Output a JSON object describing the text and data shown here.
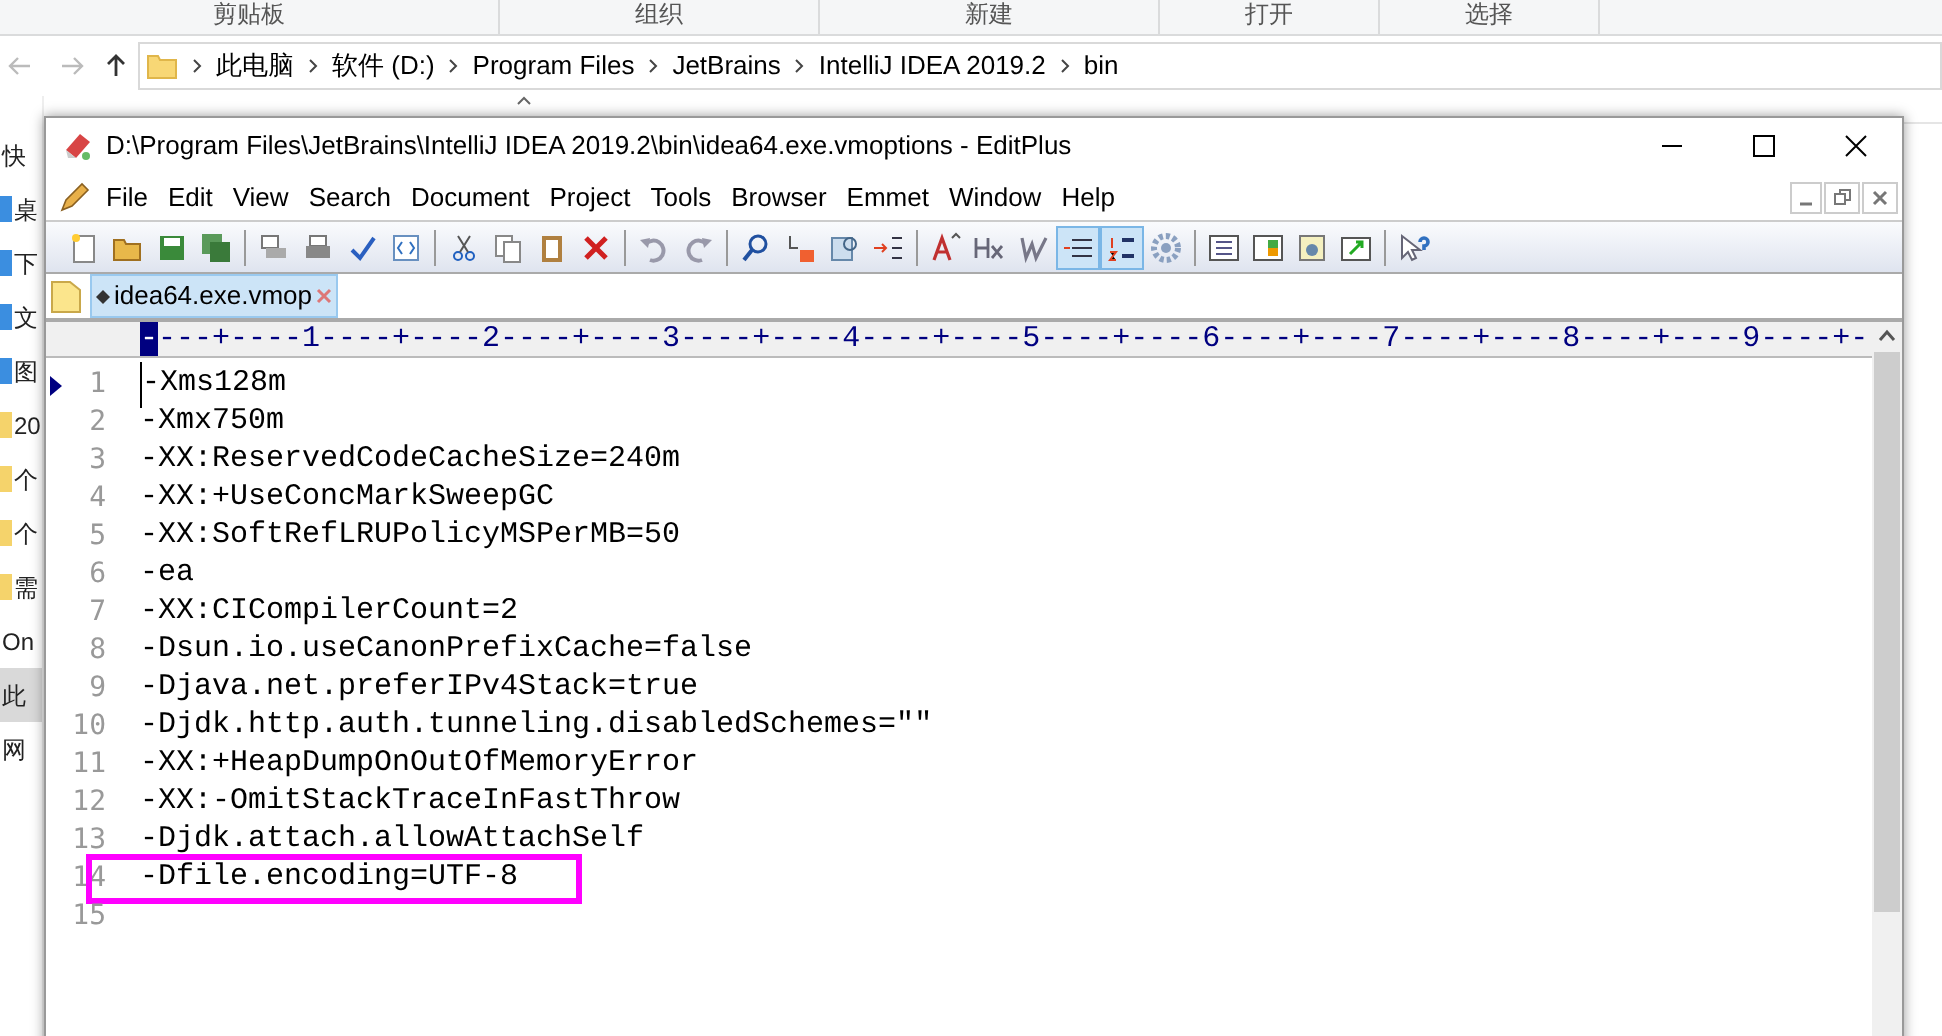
{
  "explorer": {
    "ribbon_groups": [
      "剪贴板",
      "组织",
      "新建",
      "打开",
      "选择"
    ],
    "breadcrumbs": [
      "此电脑",
      "软件 (D:)",
      "Program Files",
      "JetBrains",
      "IntelliJ IDEA 2019.2",
      "bin"
    ],
    "nav_items": [
      {
        "label": "快",
        "kind": "text",
        "selected": false
      },
      {
        "label": "桌",
        "kind": "icon",
        "selected": false
      },
      {
        "label": "下",
        "kind": "icon",
        "selected": false
      },
      {
        "label": "文",
        "kind": "icon",
        "selected": false
      },
      {
        "label": "图",
        "kind": "icon",
        "selected": false
      },
      {
        "label": "20",
        "kind": "folder",
        "selected": false
      },
      {
        "label": "个",
        "kind": "folder",
        "selected": false
      },
      {
        "label": "个",
        "kind": "folder",
        "selected": false
      },
      {
        "label": "需",
        "kind": "folder",
        "selected": false
      },
      {
        "label": "On",
        "kind": "text",
        "selected": false
      },
      {
        "label": "此",
        "kind": "text",
        "selected": true
      },
      {
        "label": "网",
        "kind": "text",
        "selected": false
      }
    ]
  },
  "window": {
    "title": "D:\\Program Files\\JetBrains\\IntelliJ IDEA 2019.2\\bin\\idea64.exe.vmoptions - EditPlus"
  },
  "menu": [
    "File",
    "Edit",
    "View",
    "Search",
    "Document",
    "Project",
    "Tools",
    "Browser",
    "Emmet",
    "Window",
    "Help"
  ],
  "toolbar": {
    "word_wrap_pressed": true,
    "line_numbers_pressed": true
  },
  "tabs": [
    {
      "label": "idea64.exe.vmop",
      "selected": true
    }
  ],
  "ruler": "----+----1----+----2----+----3----+----4----+----5----+----6----+----7----+----8----+----9----+-",
  "lines": [
    {
      "number": "1",
      "text": "-Xms128m",
      "current": true,
      "highlighted": false
    },
    {
      "number": "2",
      "text": "-Xmx750m",
      "current": false,
      "highlighted": false
    },
    {
      "number": "3",
      "text": "-XX:ReservedCodeCacheSize=240m",
      "current": false,
      "highlighted": false
    },
    {
      "number": "4",
      "text": "-XX:+UseConcMarkSweepGC",
      "current": false,
      "highlighted": false
    },
    {
      "number": "5",
      "text": "-XX:SoftRefLRUPolicyMSPerMB=50",
      "current": false,
      "highlighted": false
    },
    {
      "number": "6",
      "text": "-ea",
      "current": false,
      "highlighted": false
    },
    {
      "number": "7",
      "text": "-XX:CICompilerCount=2",
      "current": false,
      "highlighted": false
    },
    {
      "number": "8",
      "text": "-Dsun.io.useCanonPrefixCache=false",
      "current": false,
      "highlighted": false
    },
    {
      "number": "9",
      "text": "-Djava.net.preferIPv4Stack=true",
      "current": false,
      "highlighted": false
    },
    {
      "number": "10",
      "text": "-Djdk.http.auth.tunneling.disabledSchemes=\"\"",
      "current": false,
      "highlighted": false
    },
    {
      "number": "11",
      "text": "-XX:+HeapDumpOnOutOfMemoryError",
      "current": false,
      "highlighted": false
    },
    {
      "number": "12",
      "text": "-XX:-OmitStackTraceInFastThrow",
      "current": false,
      "highlighted": false
    },
    {
      "number": "13",
      "text": "-Djdk.attach.allowAttachSelf",
      "current": false,
      "highlighted": false
    },
    {
      "number": "14",
      "text": "-Dfile.encoding=UTF-8",
      "current": false,
      "highlighted": true
    },
    {
      "number": "15",
      "current": false,
      "highlighted": false
    }
  ]
}
